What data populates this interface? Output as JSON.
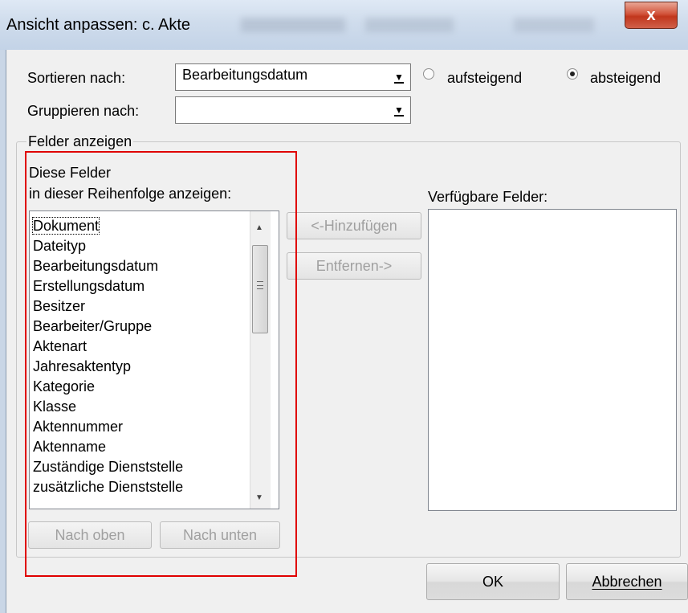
{
  "window": {
    "title": "Ansicht anpassen: c. Akte",
    "close_label": "x"
  },
  "sort": {
    "label": "Sortieren nach:",
    "value": "Bearbeitungsdatum",
    "asc_label": "aufsteigend",
    "desc_label": "absteigend",
    "selected": "absteigend"
  },
  "group": {
    "label": "Gruppieren nach:",
    "value": ""
  },
  "fields": {
    "group_label": "Felder anzeigen",
    "shown_caption_1": "Diese Felder",
    "shown_caption_2": "in dieser Reihenfolge anzeigen:",
    "available_caption": "Verfügbare Felder:",
    "shown_items": [
      "Dokument",
      "Dateityp",
      "Bearbeitungsdatum",
      "Erstellungsdatum",
      "Besitzer",
      "Bearbeiter/Gruppe",
      "Aktenart",
      "Jahresaktentyp",
      "Kategorie",
      "Klasse",
      "Aktennummer",
      "Aktenname",
      "Zuständige Dienststelle",
      "zusätzliche Dienststelle"
    ],
    "available_items": []
  },
  "buttons": {
    "add": "<-Hinzufügen",
    "remove": "Entfernen->",
    "up": "Nach oben",
    "down": "Nach unten",
    "ok": "OK",
    "cancel": "Abbrechen"
  },
  "colors": {
    "highlight_box": "#e00000",
    "close_button": "#c1361c"
  }
}
